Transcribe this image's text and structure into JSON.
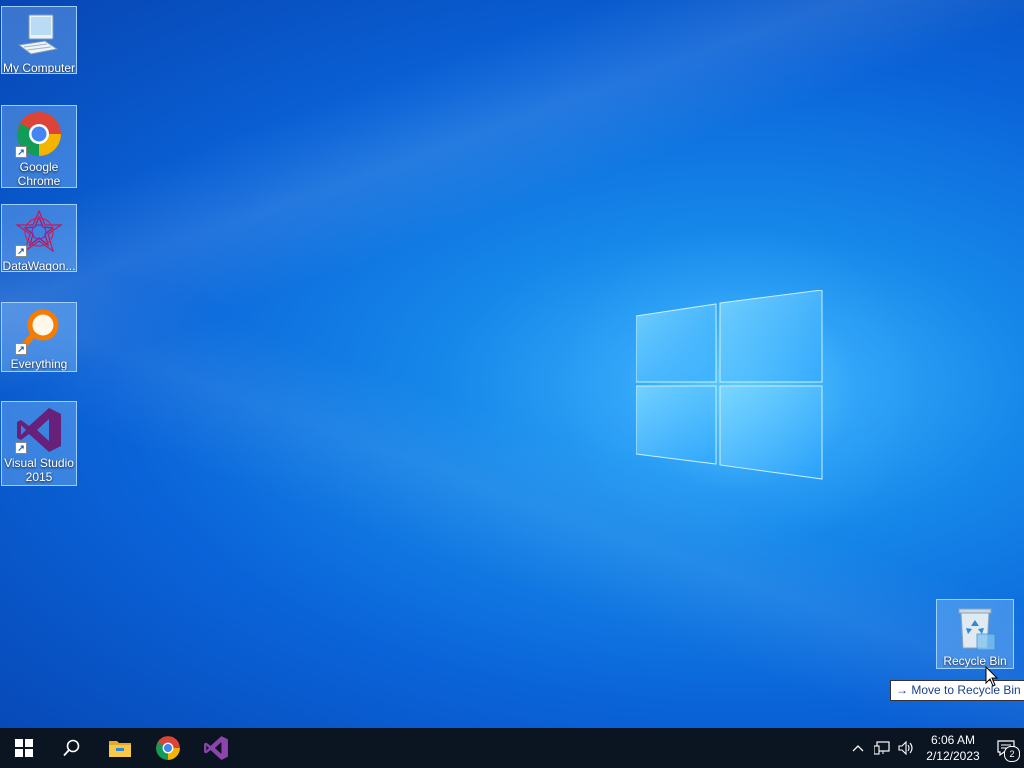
{
  "desktop": {
    "icons": [
      {
        "label": "My Computer"
      },
      {
        "label": "Google Chrome"
      },
      {
        "label": "DataWagon..."
      },
      {
        "label": "Everything"
      },
      {
        "label": "Visual Studio 2015"
      }
    ],
    "recycle_bin": {
      "label": "Recycle Bin"
    },
    "drag_tooltip": {
      "arrow": "→",
      "text": "Move to Recycle Bin"
    }
  },
  "taskbar": {
    "buttons": [
      {
        "icon": "windows-start-icon"
      },
      {
        "icon": "search-icon"
      },
      {
        "icon": "file-explorer-icon"
      },
      {
        "icon": "chrome-icon"
      },
      {
        "icon": "visual-studio-icon"
      }
    ],
    "tray": {
      "time": "6:06 AM",
      "date": "2/12/2023",
      "notification_count": "2"
    }
  },
  "colors": {
    "taskbar": "#0b1421",
    "desktop_accent": "#1688ea",
    "vs_purple": "#68217a"
  }
}
